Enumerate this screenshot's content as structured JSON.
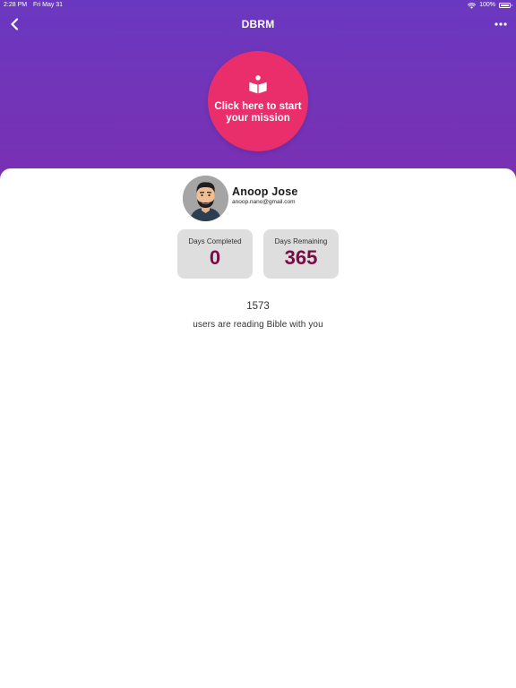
{
  "status_bar": {
    "time": "2:28 PM",
    "date": "Fri May 31",
    "battery": "100%"
  },
  "nav": {
    "title": "DBRM",
    "back_icon": "chevron-left-icon",
    "more_icon": "more-horizontal-icon"
  },
  "mission": {
    "label": "Click here to start your mission",
    "icon": "book-reader-icon",
    "color": "#ea2e6b"
  },
  "user": {
    "name": "Anoop Jose",
    "email": "anoop.nano@gmail.com"
  },
  "stats": {
    "days_completed_label": "Days Completed",
    "days_completed_value": "0",
    "days_remaining_label": "Days Remaining",
    "days_remaining_value": "365"
  },
  "community": {
    "count": "1573",
    "caption": "users are reading Bible with you"
  },
  "colors": {
    "header_top": "#6a38c0",
    "header_bottom": "#7a2fb2",
    "stat_value": "#7a0c45",
    "stat_box": "#dedede"
  }
}
